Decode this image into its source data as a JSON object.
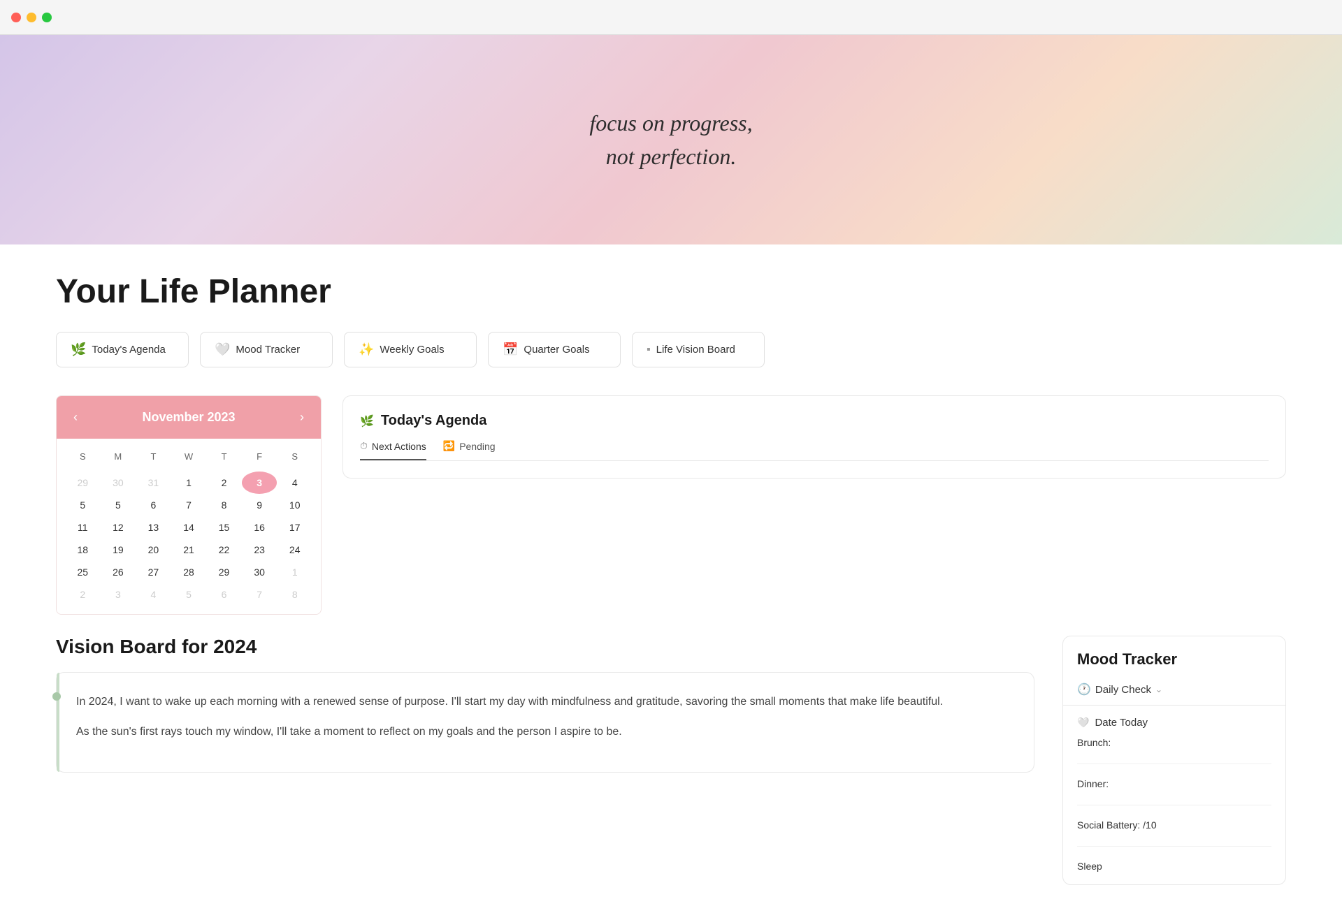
{
  "titlebar": {
    "traffic_lights": [
      "red",
      "yellow",
      "green"
    ]
  },
  "hero": {
    "quote_line1": "focus on progress,",
    "quote_line2": "not perfection."
  },
  "page": {
    "title": "Your Life Planner"
  },
  "nav_buttons": [
    {
      "id": "todays-agenda",
      "icon": "🌿",
      "label": "Today's Agenda"
    },
    {
      "id": "mood-tracker",
      "icon": "🤍",
      "label": "Mood Tracker"
    },
    {
      "id": "weekly-goals",
      "icon": "✨",
      "label": "Weekly Goals"
    },
    {
      "id": "quarter-goals",
      "icon": "📅",
      "label": "Quarter Goals"
    },
    {
      "id": "life-vision-board",
      "icon": "▪",
      "label": "Life Vision Board"
    }
  ],
  "calendar": {
    "month_year": "November 2023",
    "day_labels": [
      "S",
      "M",
      "T",
      "W",
      "T",
      "F",
      "S"
    ],
    "weeks": [
      [
        {
          "day": 29,
          "other": true
        },
        {
          "day": 30,
          "other": true
        },
        {
          "day": 31,
          "other": true
        },
        {
          "day": 1
        },
        {
          "day": 2
        },
        {
          "day": 3,
          "today": true
        },
        {
          "day": 4
        }
      ],
      [
        {
          "day": 5
        },
        {
          "day": 5
        },
        {
          "day": 6
        },
        {
          "day": 7
        },
        {
          "day": 8
        },
        {
          "day": 9
        },
        {
          "day": 10
        }
      ],
      [
        {
          "day": 11
        },
        {
          "day": 12
        },
        {
          "day": 13
        },
        {
          "day": 14
        },
        {
          "day": 15
        },
        {
          "day": 16
        },
        {
          "day": 17
        }
      ],
      [
        {
          "day": 18
        },
        {
          "day": 19
        },
        {
          "day": 20
        },
        {
          "day": 21
        },
        {
          "day": 22
        },
        {
          "day": 23
        },
        {
          "day": 24
        }
      ],
      [
        {
          "day": 25
        },
        {
          "day": 26
        },
        {
          "day": 27
        },
        {
          "day": 28
        },
        {
          "day": 29
        },
        {
          "day": 30
        },
        {
          "day": 1,
          "other": true
        }
      ],
      [
        {
          "day": 2,
          "other": true
        },
        {
          "day": 3,
          "other": true
        },
        {
          "day": 4,
          "other": true
        },
        {
          "day": 5,
          "other": true
        },
        {
          "day": 6,
          "other": true
        },
        {
          "day": 7,
          "other": true
        },
        {
          "day": 8,
          "other": true
        }
      ]
    ]
  },
  "agenda": {
    "icon": "🌿",
    "title": "Today's Agenda",
    "tabs": [
      {
        "id": "next-actions",
        "icon": "⏱",
        "label": "Next Actions",
        "active": true
      },
      {
        "id": "pending",
        "icon": "🔁",
        "label": "Pending",
        "active": false
      }
    ]
  },
  "vision_board": {
    "title": "Vision Board for 2024",
    "paragraphs": [
      "In 2024, I want to wake up each morning with a renewed sense of purpose. I'll start my day with mindfulness and gratitude, savoring the small moments that make life beautiful.",
      "As the sun's first rays touch my window, I'll take a moment to reflect on my goals and the person I aspire to be."
    ]
  },
  "mood_tracker": {
    "title": "Mood Tracker",
    "daily_check": {
      "icon": "🕐",
      "label": "Daily Check"
    },
    "table": {
      "icon": "🤍",
      "title": "Date Today",
      "rows": [
        {
          "label": "Brunch:",
          "value": ""
        },
        {
          "label": "Dinner:",
          "value": ""
        },
        {
          "label": "Social Battery: /10",
          "value": ""
        },
        {
          "label": "Sleep",
          "value": ""
        }
      ]
    }
  }
}
